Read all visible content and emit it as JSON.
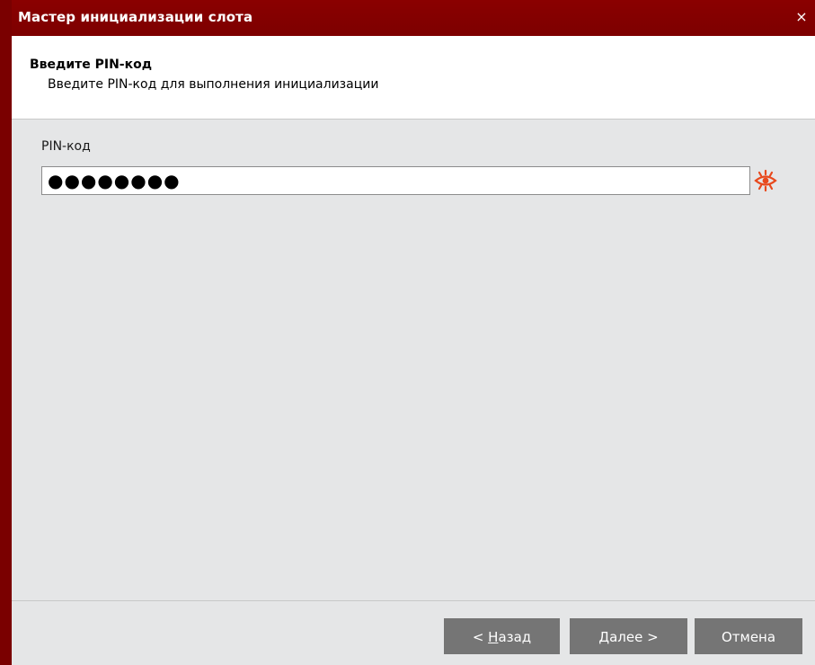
{
  "window": {
    "title": "Мастер инициализации слота",
    "close_glyph": "×"
  },
  "header": {
    "title": "Введите PIN-код",
    "subtitle": "Введите PIN-код для выполнения инициализации"
  },
  "form": {
    "pin_label": "PIN-код",
    "pin_value_masked": "●●●●●●●●"
  },
  "icons": {
    "show_password": "eye-icon"
  },
  "buttons": {
    "back_prefix": "< ",
    "back_mnemonic": "Н",
    "back_rest": "азад",
    "next_mnemonic": "Д",
    "next_rest": "алее >",
    "cancel": "Отмена"
  },
  "colors": {
    "titlebar": "#7d0000",
    "accent_icon": "#e8491d",
    "button_bg": "#757575",
    "panel_bg": "#e5e6e7"
  }
}
